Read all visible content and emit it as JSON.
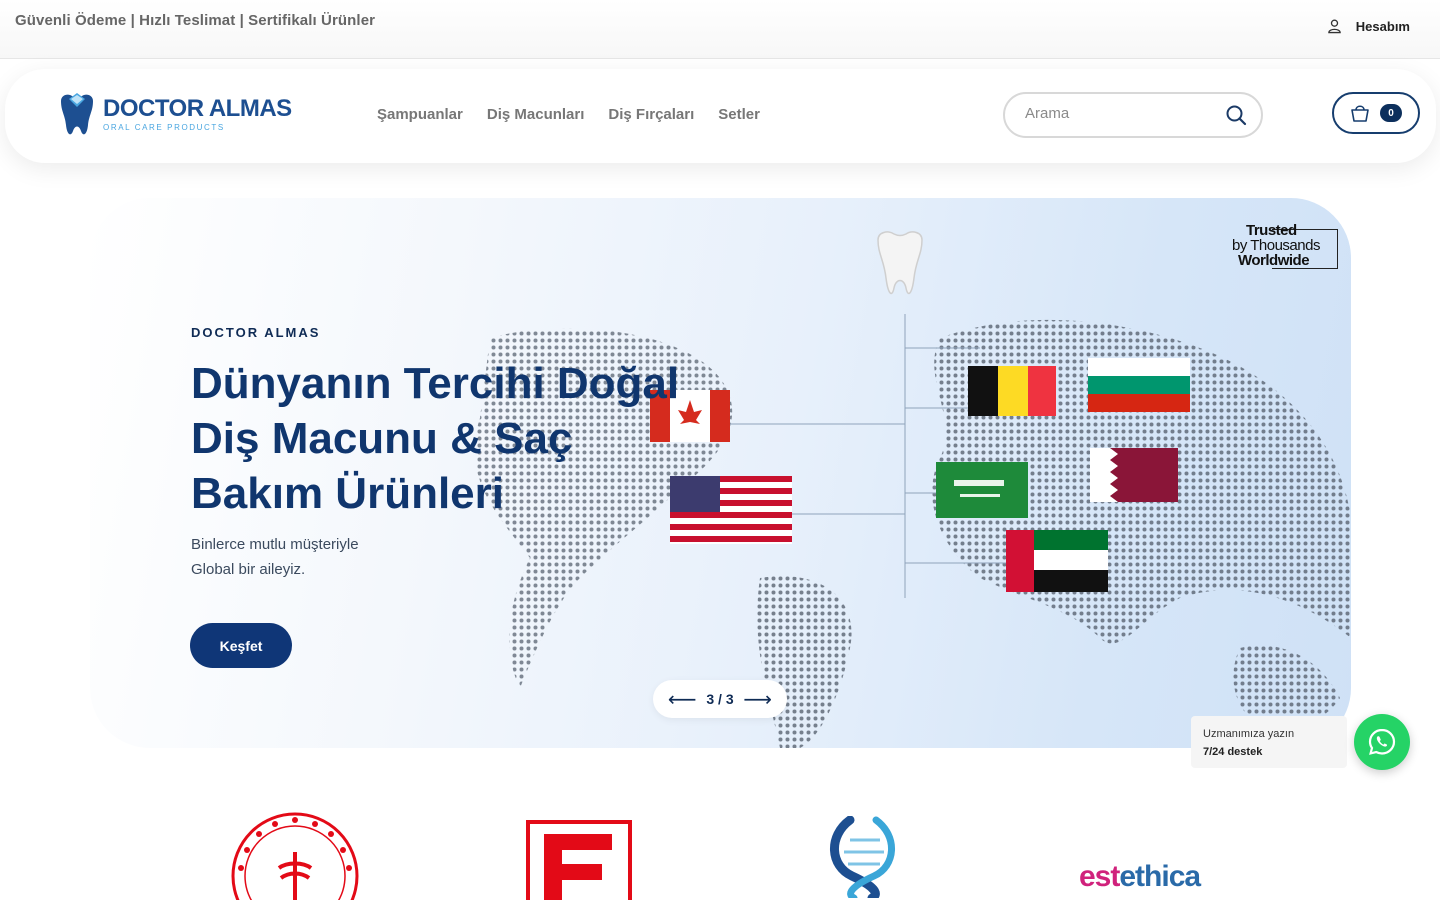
{
  "topbar": {
    "promo": "Güvenli Ödeme | Hızlı Teslimat | Sertifikalı Ürünler",
    "account_label": "Hesabım",
    "account_icon": "user-icon"
  },
  "header": {
    "logo_brand": "DOCTOR ALMAS",
    "logo_sub": "ORAL CARE PRODUCTS",
    "nav": [
      {
        "label": "Şampuanlar"
      },
      {
        "label": "Diş Macunları"
      },
      {
        "label": "Diş Fırçaları"
      },
      {
        "label": "Setler"
      }
    ],
    "search_placeholder": "Arama",
    "search_icon": "search-icon",
    "cart_icon": "shopping-bag-icon",
    "cart_count": "0"
  },
  "hero": {
    "kicker": "DOCTOR ALMAS",
    "title": "Dünyanın Tercihi Doğal Diş Macunu & Saç Bakım Ürünleri",
    "desc_line1": "Binlerce mutlu müşteriyle",
    "desc_line2": "Global bir aileyiz.",
    "cta": "Keşfet",
    "pager": "3 / 3",
    "prev_arrow": "⟵",
    "next_arrow": "⟶",
    "trusted_1": "Trusted",
    "trusted_2": "by Thousands",
    "trusted_3": "Worldwide"
  },
  "whatsapp": {
    "line1": "Uzmanımıza yazın",
    "line2": "7/24 destek",
    "icon": "whatsapp-icon"
  },
  "certifications": {
    "estethica_1": "est",
    "estethica_2": "ethica"
  },
  "colors": {
    "brand_navy": "#0f3677",
    "whatsapp_green": "#25d366"
  }
}
